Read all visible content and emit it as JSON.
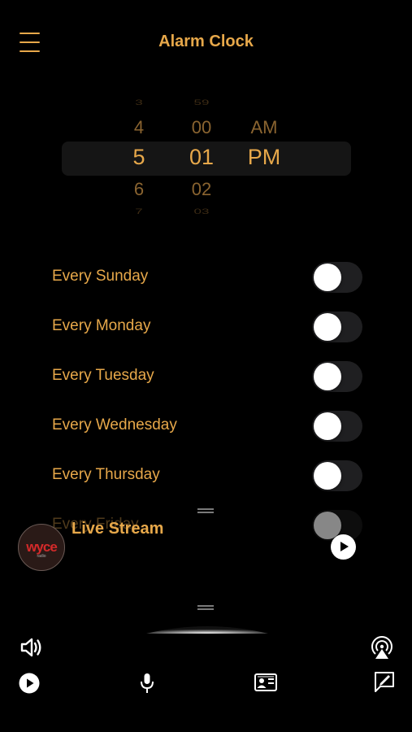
{
  "header": {
    "title": "Alarm Clock"
  },
  "picker": {
    "hours": {
      "far_top": "3",
      "near_top": "4",
      "selected": "5",
      "near_bottom": "6",
      "far_bottom": "7"
    },
    "minutes": {
      "far_top": "59",
      "near_top": "00",
      "selected": "01",
      "near_bottom": "02",
      "far_bottom": "03"
    },
    "period": {
      "near_top": "AM",
      "selected": "PM"
    }
  },
  "days": [
    {
      "label": "Every Sunday",
      "on": false
    },
    {
      "label": "Every Monday",
      "on": false
    },
    {
      "label": "Every Tuesday",
      "on": false
    },
    {
      "label": "Every Wednesday",
      "on": false
    },
    {
      "label": "Every Thursday",
      "on": false
    },
    {
      "label": "Every Friday",
      "on": false
    }
  ],
  "player": {
    "title": "Live Stream",
    "station_logo_text": "wyce",
    "station_logo_sub": "radio"
  },
  "toolbar": {
    "icons": [
      "volume-icon",
      "airplay-icon",
      "play-icon",
      "microphone-icon",
      "contact-card-icon",
      "compose-icon"
    ]
  },
  "colors": {
    "accent": "#e7a84a",
    "background": "#000000",
    "toggle_off": "#1f1f21"
  }
}
